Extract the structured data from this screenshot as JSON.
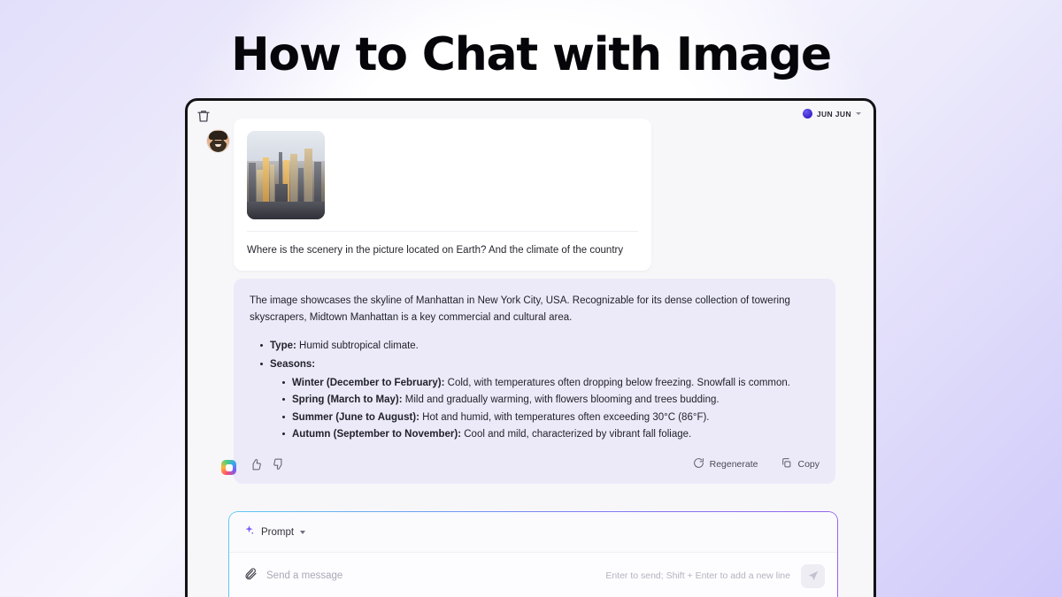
{
  "page": {
    "title": "How to Chat with Image"
  },
  "window": {
    "trash_icon": "trash-icon",
    "account": {
      "name": "JUN JUN",
      "caret_icon": "chevron-down-icon",
      "avatar_color": "#3c22c9"
    }
  },
  "conversation": {
    "user_message": {
      "avatar_icon": "user-avatar-memoji",
      "attachment_alt": "Manhattan skyline photo",
      "text": "Where is the scenery in the picture located on Earth? And the climate of the country"
    },
    "assistant_message": {
      "avatar_icon": "assistant-logo-icon",
      "intro": "The image showcases the skyline of Manhattan in New York City, USA. Recognizable for its dense collection of towering skyscrapers, Midtown Manhattan is a key commercial and cultural area.",
      "items": [
        {
          "label": "Type:",
          "text": " Humid subtropical climate."
        },
        {
          "label": "Seasons:",
          "text": ""
        }
      ],
      "seasons": [
        {
          "label": "Winter (December to February):",
          "text": " Cold, with temperatures often dropping below freezing. Snowfall is common."
        },
        {
          "label": "Spring (March to May):",
          "text": " Mild and gradually warming, with flowers blooming and trees budding."
        },
        {
          "label": "Summer (June to August):",
          "text": " Hot and humid, with temperatures often exceeding 30°C (86°F)."
        },
        {
          "label": "Autumn (September to November):",
          "text": " Cool and mild, characterized by vibrant fall foliage."
        }
      ],
      "actions": {
        "thumbs_up_icon": "thumbs-up-icon",
        "thumbs_down_icon": "thumbs-down-icon",
        "regenerate_label": "Regenerate",
        "regenerate_icon": "refresh-icon",
        "copy_label": "Copy",
        "copy_icon": "copy-icon"
      }
    }
  },
  "composer": {
    "prompt_label": "Prompt",
    "prompt_sparkle_icon": "sparkle-icon",
    "prompt_caret_icon": "chevron-down-icon",
    "attach_icon": "paperclip-icon",
    "input_value": "",
    "input_placeholder": "Send a message",
    "hint": "Enter to send; Shift + Enter to add a new line",
    "send_icon": "send-icon"
  },
  "colors": {
    "accent_purple": "#7b7ef0",
    "assistant_bubble": "#eceaf8",
    "panel": "#f7f7fa"
  }
}
